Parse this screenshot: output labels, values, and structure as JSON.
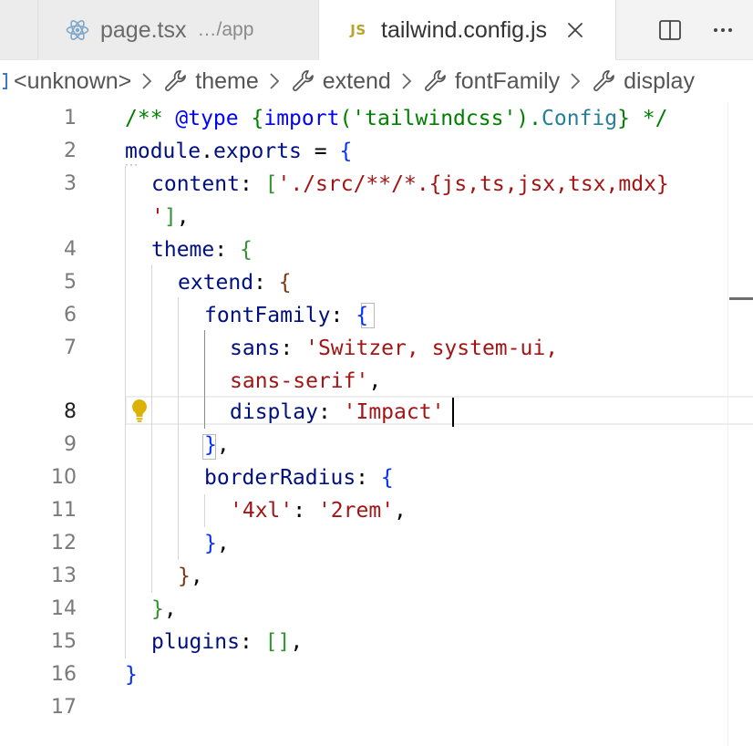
{
  "tabs": [
    {
      "name": "page.tsx",
      "description": "…/app",
      "active": false
    },
    {
      "name": "tailwind.config.js",
      "badge": "JS",
      "active": true
    }
  ],
  "breadcrumb": {
    "items": [
      "<unknown>",
      "theme",
      "extend",
      "fontFamily",
      "display"
    ]
  },
  "editor": {
    "current_line": 8,
    "line_numbers": [
      "1",
      "2",
      "3",
      "",
      "4",
      "5",
      "6",
      "7",
      "",
      "8",
      "9",
      "10",
      "11",
      "12",
      "13",
      "14",
      "15",
      "16",
      "17"
    ],
    "tokens": {
      "l1_a": "/** ",
      "l1_b": "@type",
      "l1_c": " {",
      "l1_d": "import",
      "l1_e": "('tailwindcss').",
      "l1_f": "Config",
      "l1_g": "} */",
      "l2_a": "module",
      "l2_b": ".",
      "l2_c": "exports",
      "l2_d": " = ",
      "l2_e": "{",
      "l3_a": "content",
      "l3_b": ": ",
      "l3_c": "[",
      "l3_d": "'./src/**/*.{js,ts,jsx,tsx,mdx}",
      "l3w_a": "'",
      "l3w_b": "]",
      "l3w_c": ",",
      "l4_a": "theme",
      "l4_b": ": ",
      "l4_c": "{",
      "l5_a": "extend",
      "l5_b": ": ",
      "l5_c": "{",
      "l6_a": "fontFamily",
      "l6_b": ": ",
      "l6_c": "{",
      "l7_a": "sans",
      "l7_b": ": ",
      "l7_c": "'Switzer, system-ui,",
      "l7w_a": "sans-serif'",
      "l7w_b": ",",
      "l8_a": "display",
      "l8_b": ": ",
      "l8_c": "'Impact'",
      "l9_a": "}",
      "l9_b": ",",
      "l10_a": "borderRadius",
      "l10_b": ": ",
      "l10_c": "{",
      "l11_a": "'4xl'",
      "l11_b": ": ",
      "l11_c": "'2rem'",
      "l11_d": ",",
      "l12_a": "}",
      "l12_b": ",",
      "l13_a": "}",
      "l13_b": ",",
      "l14_a": "}",
      "l14_b": ",",
      "l15_a": "plugins",
      "l15_b": ": ",
      "l15_c": "[]",
      "l15_d": ",",
      "l16_a": "}"
    }
  },
  "icons": {
    "react_tab_icon": "react-icon",
    "split_editor": "split-editor-icon",
    "more_actions": "more-actions-icon",
    "close_tab": "close-icon",
    "breadcrumb_item": "wrench-icon",
    "lightbulb": "lightbulb-icon"
  },
  "colors": {
    "comment": "#008000",
    "keyword": "#0000ff",
    "string": "#a31515",
    "variable": "#001080",
    "bracket_level1": "#0431fa",
    "bracket_level2": "#319331",
    "bracket_level3": "#7b3814",
    "js_badge": "#b7a32d",
    "lightbulb": "#ddb100"
  }
}
